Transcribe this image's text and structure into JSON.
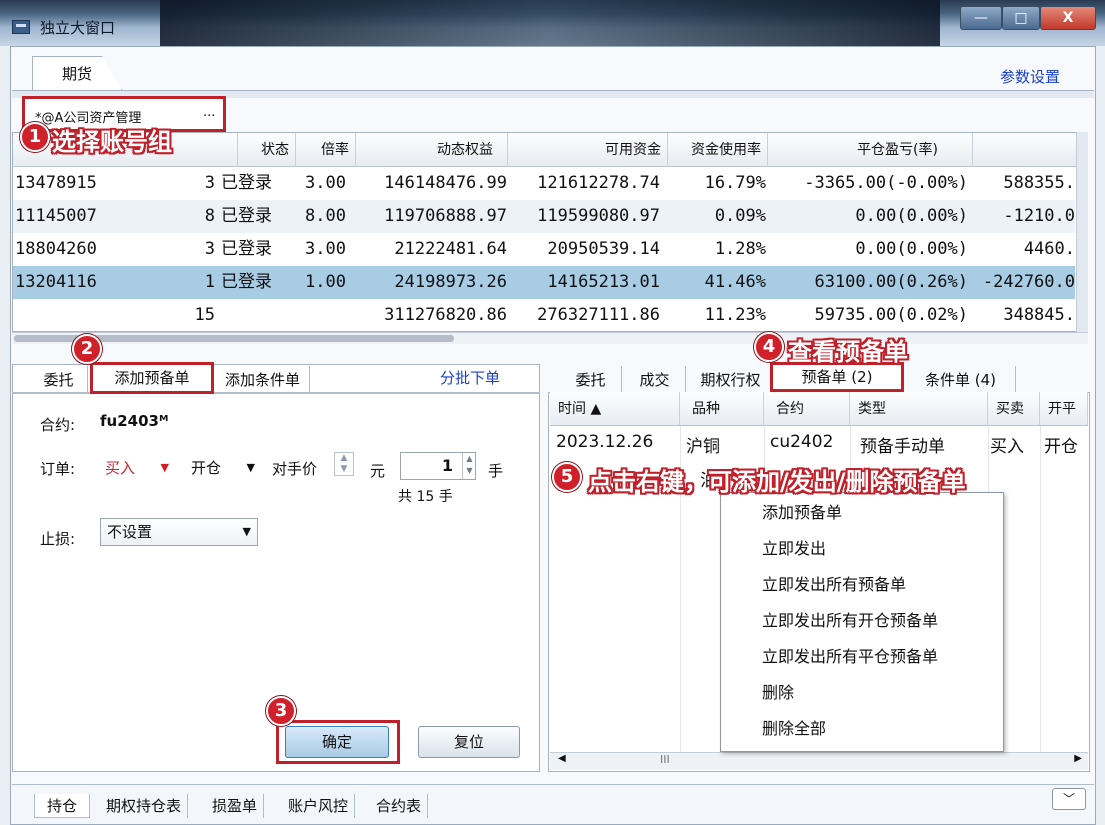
{
  "window": {
    "title": "独立大窗口",
    "min_glyph": "—",
    "max_glyph": "□",
    "close_glyph": "X"
  },
  "tabs": {
    "futures": "期货",
    "param_settings": "参数设置"
  },
  "account_group": {
    "value": "*@A公司资产管理",
    "more": "..."
  },
  "callouts": {
    "c1": {
      "num": "1",
      "text": "选择账号组"
    },
    "c2": {
      "num": "2"
    },
    "c3": {
      "num": "3"
    },
    "c4": {
      "num": "4",
      "text": "查看预备单"
    },
    "c5": {
      "num": "5",
      "text": "点击右键，可添加/发出/删除预备单"
    }
  },
  "account_table": {
    "columns": [
      "状态",
      "倍率",
      "动态权益",
      "可用资金",
      "资金使用率",
      "平仓盈亏(率)"
    ],
    "rows": [
      {
        "account": "13478915",
        "count": "3",
        "status": "已登录",
        "rate": "3.00",
        "equity": "146148476.99",
        "available": "121612278.74",
        "usage": "16.79%",
        "pnl": "-3365.00(-0.00%)",
        "extra": "588355."
      },
      {
        "account": "11145007",
        "count": "8",
        "status": "已登录",
        "rate": "8.00",
        "equity": "119706888.97",
        "available": "119599080.97",
        "usage": "0.09%",
        "pnl": "0.00(0.00%)",
        "extra": "-1210.0"
      },
      {
        "account": "18804260",
        "count": "3",
        "status": "已登录",
        "rate": "3.00",
        "equity": "21222481.64",
        "available": "20950539.14",
        "usage": "1.28%",
        "pnl": "0.00(0.00%)",
        "extra": "4460."
      },
      {
        "account": "13204116",
        "count": "1",
        "status": "已登录",
        "rate": "1.00",
        "equity": "24198973.26",
        "available": "14165213.01",
        "usage": "41.46%",
        "pnl": "63100.00(0.26%)",
        "extra": "-242760.0"
      }
    ],
    "total": {
      "count": "15",
      "equity": "311276820.86",
      "available": "276327111.86",
      "usage": "11.23%",
      "pnl": "59735.00(0.02%)",
      "extra": "348845."
    }
  },
  "left_panel": {
    "tabs": [
      "委托",
      "添加预备单",
      "添加条件单"
    ],
    "batch_order": "分批下单",
    "contract_label": "合约:",
    "contract_value": "fu2403ᴹ",
    "order_label": "订单:",
    "direction": "买入",
    "offset": "开仓",
    "price_type": "对手价",
    "price_unit": "元",
    "quantity": "1",
    "qty_unit": "手",
    "total_lots": "共 15 手",
    "stoploss_label": "止损:",
    "stoploss_value": "不设置",
    "confirm": "确定",
    "reset": "复位"
  },
  "right_panel": {
    "tabs": [
      "委托",
      "成交",
      "期权行权",
      "预备单 (2)",
      "条件单 (4)"
    ],
    "columns": [
      "时间 ▲",
      "品种",
      "合约",
      "类型",
      "买卖",
      "开平"
    ],
    "row": {
      "time": "2023.12.26",
      "product": "沪铜",
      "contract": "cu2402",
      "type": "预备手动单",
      "side": "买入",
      "offset": "开仓"
    },
    "row2_partial": "油",
    "scroll_mark": "III"
  },
  "context_menu": [
    "添加预备单",
    "立即发出",
    "立即发出所有预备单",
    "立即发出所有开仓预备单",
    "立即发出所有平仓预备单",
    "删除",
    "删除全部"
  ],
  "bottom_tabs": [
    "持仓",
    "期权持仓表",
    "损盈单",
    "账户风控",
    "合约表"
  ],
  "bottom_expand": "﹀"
}
